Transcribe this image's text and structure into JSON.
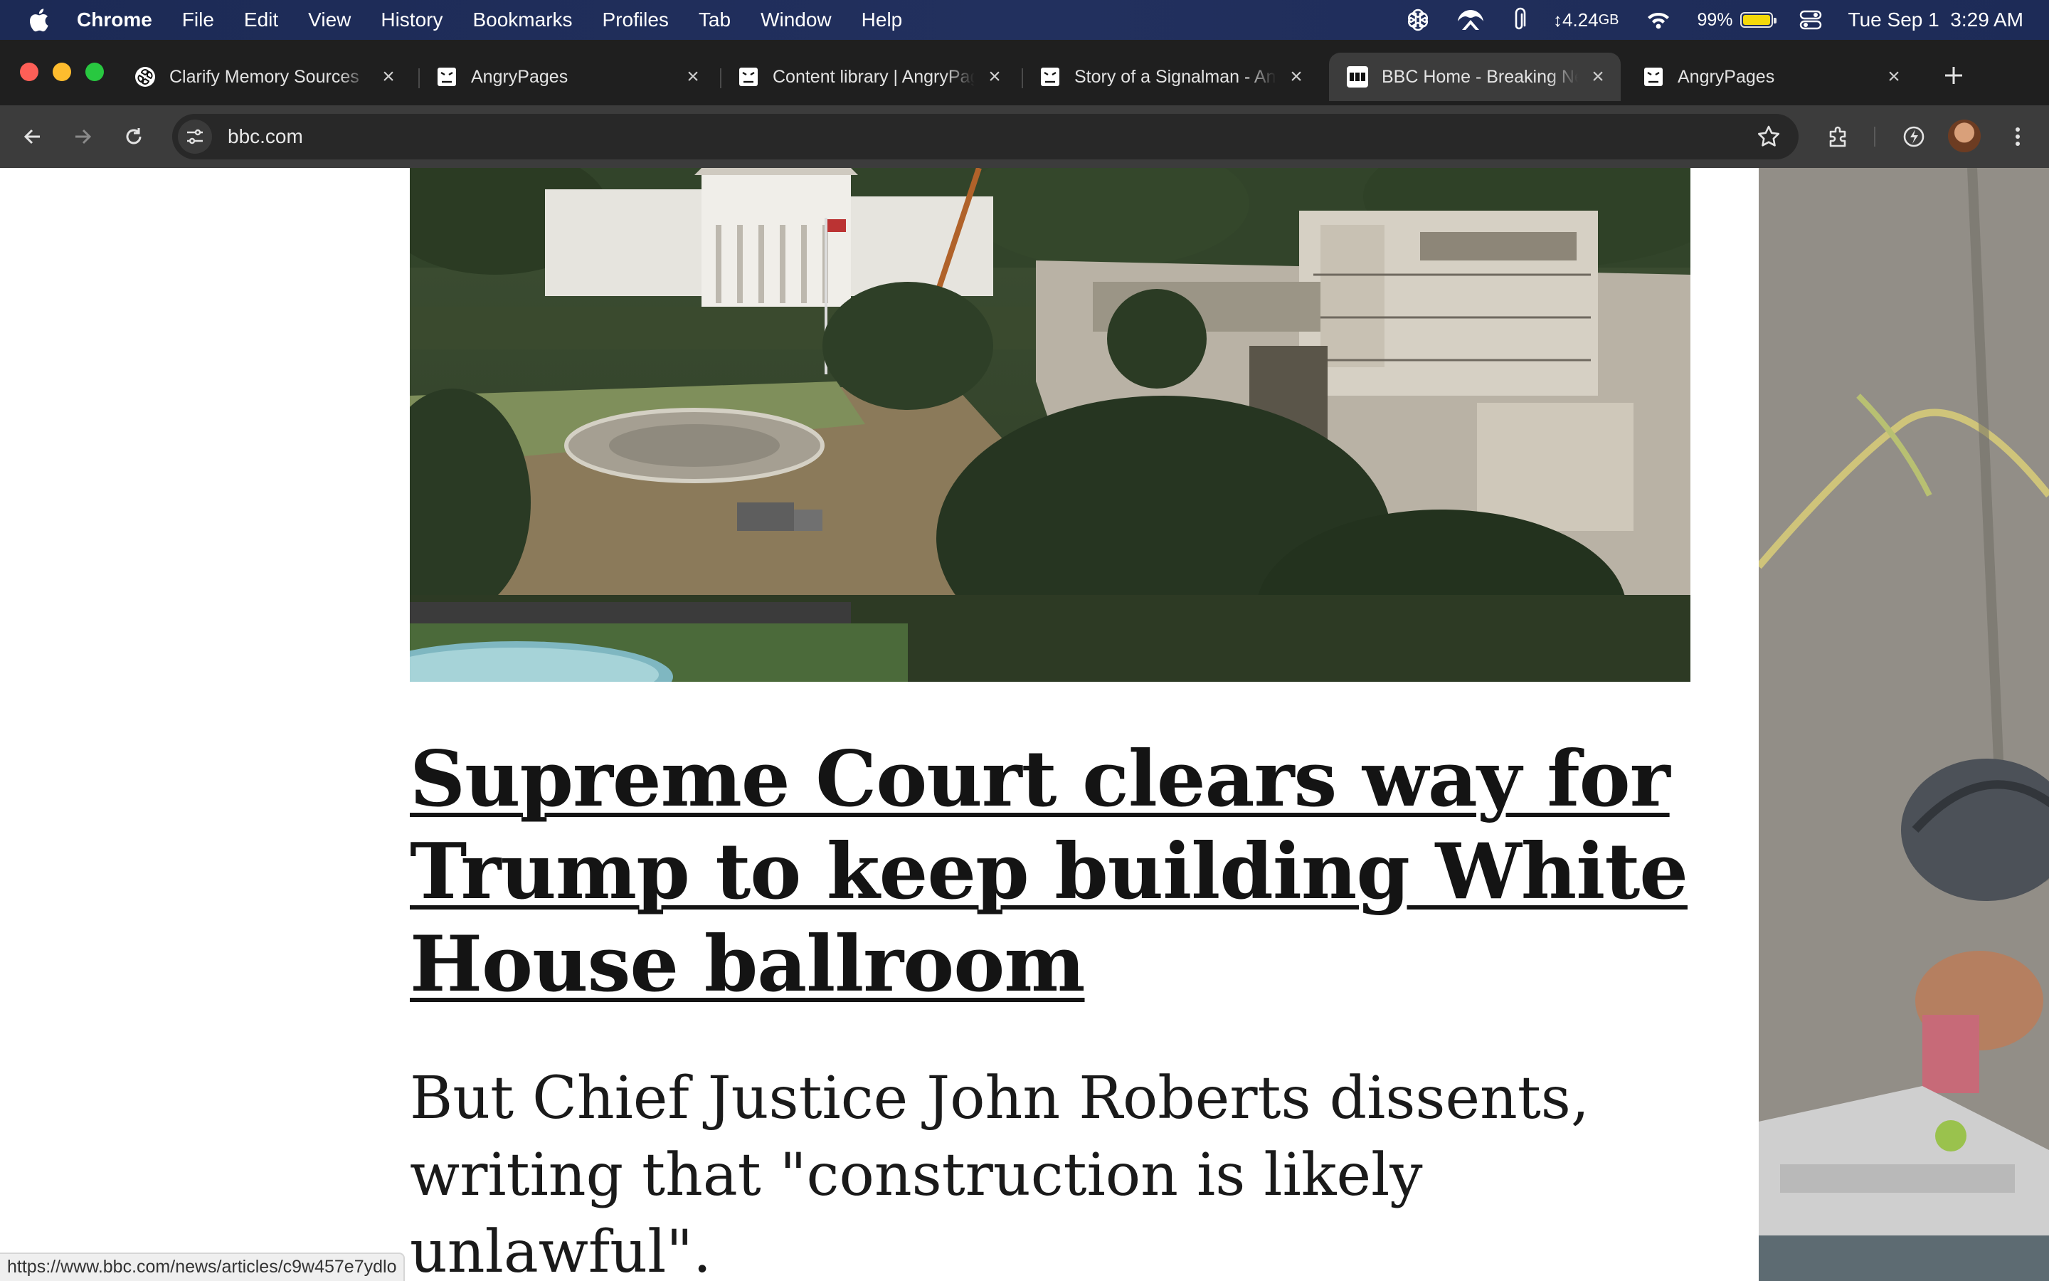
{
  "menubar": {
    "app_name": "Chrome",
    "items": [
      "File",
      "Edit",
      "View",
      "History",
      "Bookmarks",
      "Profiles",
      "Tab",
      "Window",
      "Help"
    ],
    "memory_value": "4.24",
    "memory_unit": "GB",
    "battery_percent": "99%",
    "battery_level": 0.99,
    "datetime": "Tue Sep 1  3:29 AM"
  },
  "tabs": [
    {
      "title": "Clarify Memory Sources",
      "icon": "openai-icon",
      "active": false
    },
    {
      "title": "AngryPages",
      "icon": "angrypages-icon",
      "active": false
    },
    {
      "title": "Content library | AngryPages",
      "icon": "angrypages-icon",
      "active": false
    },
    {
      "title": "Story of a Signalman - AngryPages",
      "icon": "angrypages-icon",
      "active": false
    },
    {
      "title": "BBC Home - Breaking News",
      "icon": "bbc-icon",
      "active": true
    },
    {
      "title": "AngryPages",
      "icon": "angrypages-icon",
      "active": false
    }
  ],
  "toolbar": {
    "url": "bbc.com"
  },
  "article": {
    "headline": "Supreme Court clears way for Trump to keep building White House ballroom",
    "summary": "But Chief Justice John Roberts dissents, writing that \"construction is likely unlawful\"."
  },
  "status_bar": {
    "hover_url": "https://www.bbc.com/news/articles/c9w457e7ydlo"
  },
  "colors": {
    "menubar": "#1c2a55",
    "tabstrip": "#1f1f1f",
    "toolbar": "#3c3c3c",
    "omnibox": "#282828",
    "headline_text": "#141414"
  }
}
